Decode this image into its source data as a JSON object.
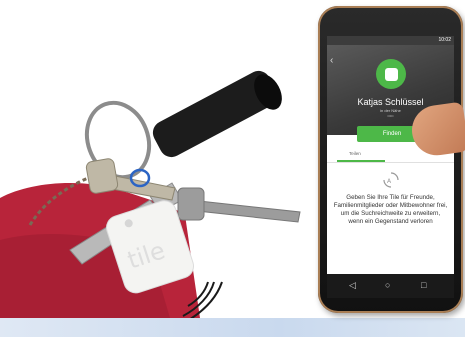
{
  "phone": {
    "status_time": "10:02",
    "tile_name": "Katjas Schlüssel",
    "tile_location": "in der Nähe",
    "find_button": "Finden",
    "tab_left": "Teilen",
    "share_message": "Geben Sie Ihre Tile für Freunde, Familienmitglieder oder Mitbewohner frei, um die Suchreichweite zu erweitern, wenn ein Gegenstand verloren"
  },
  "keychain": {
    "tag_logo": "tile"
  },
  "colors": {
    "tile_green": "#4db848",
    "pouch_red": "#b8243a",
    "tile_white": "#f4f4f2"
  }
}
